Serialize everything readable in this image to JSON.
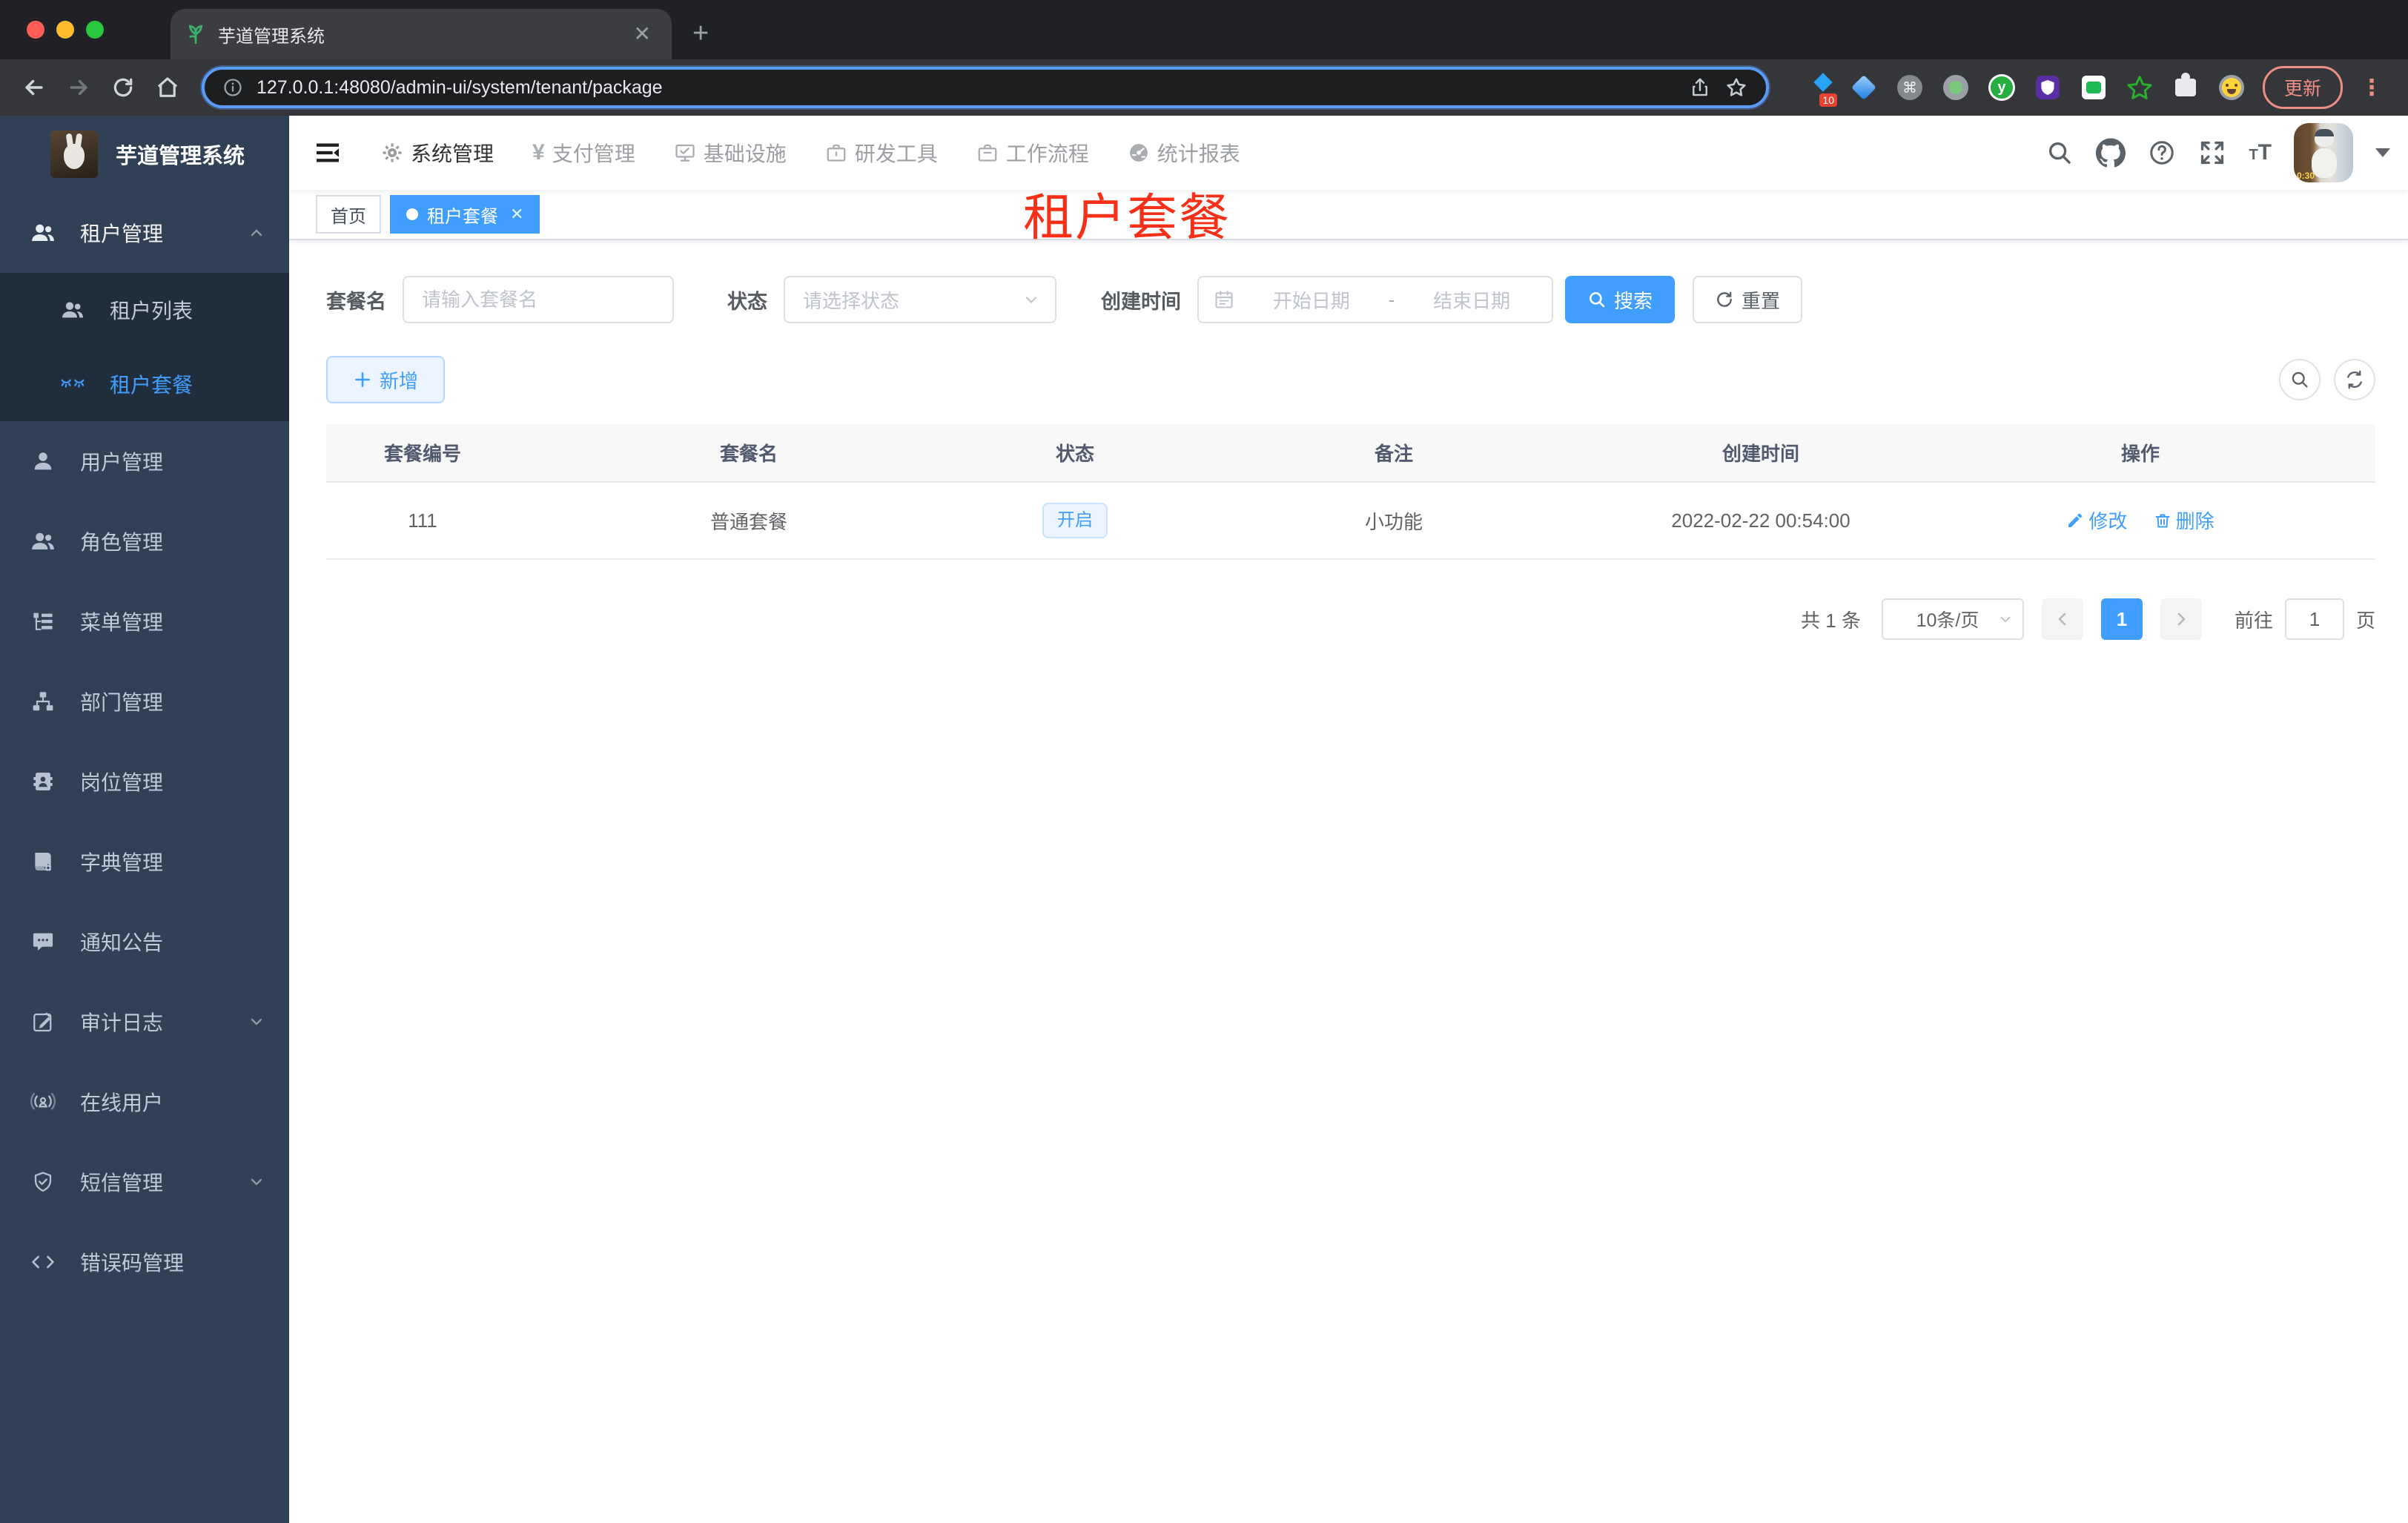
{
  "browser": {
    "tab_title": "芋道管理系统",
    "close_glyph": "✕",
    "newtab_glyph": "+",
    "url": "127.0.0.1:48080/admin-ui/system/tenant/package",
    "ext_badge": "10",
    "ext_y_glyph": "y",
    "ext_command_glyph": "⌘",
    "update_label": "更新",
    "menu_dots_glyph": "⋮"
  },
  "sidebar": {
    "app_title": "芋道管理系统",
    "items": [
      {
        "label": "租户管理"
      },
      {
        "label": "租户列表"
      },
      {
        "label": "租户套餐"
      },
      {
        "label": "用户管理"
      },
      {
        "label": "角色管理"
      },
      {
        "label": "菜单管理"
      },
      {
        "label": "部门管理"
      },
      {
        "label": "岗位管理"
      },
      {
        "label": "字典管理"
      },
      {
        "label": "通知公告"
      },
      {
        "label": "审计日志"
      },
      {
        "label": "在线用户"
      },
      {
        "label": "短信管理"
      },
      {
        "label": "错误码管理"
      }
    ]
  },
  "topnav": {
    "items": [
      {
        "label": "系统管理"
      },
      {
        "label": "支付管理"
      },
      {
        "label": "基础设施"
      },
      {
        "label": "研发工具"
      },
      {
        "label": "工作流程"
      },
      {
        "label": "统计报表"
      }
    ],
    "yen_glyph": "¥",
    "font_size_glyph_small": "T",
    "font_size_glyph_big": "T"
  },
  "tags": {
    "home": "首页",
    "active": "租户套餐",
    "close_glyph": "✕"
  },
  "overlay": {
    "title": "租户套餐"
  },
  "filters": {
    "name_label": "套餐名",
    "name_placeholder": "请输入套餐名",
    "status_label": "状态",
    "status_placeholder": "请选择状态",
    "date_label": "创建时间",
    "date_start_placeholder": "开始日期",
    "date_separator": "-",
    "date_end_placeholder": "结束日期",
    "search_label": "搜索",
    "reset_label": "重置"
  },
  "actions": {
    "add_label": "新增"
  },
  "table": {
    "columns": [
      "套餐编号",
      "套餐名",
      "状态",
      "备注",
      "创建时间",
      "操作"
    ],
    "rows": [
      {
        "id": "111",
        "name": "普通套餐",
        "status": "开启",
        "remark": "小功能",
        "created": "2022-02-22 00:54:00",
        "edit_label": "修改",
        "delete_label": "删除"
      }
    ]
  },
  "pagination": {
    "total": "共 1 条",
    "page_size": "10条/页",
    "current_page": "1",
    "goto_label": "前往",
    "goto_value": "1",
    "goto_unit": "页"
  },
  "colors": {
    "primary": "#409eff",
    "overlay_red": "#f93018",
    "sidebar_bg": "#304156",
    "submenu_bg": "#1f2d3d",
    "tag_active_bg": "#409eff",
    "status_badge_bg": "#ecf5ff",
    "update_pill": "#ef8e85"
  }
}
